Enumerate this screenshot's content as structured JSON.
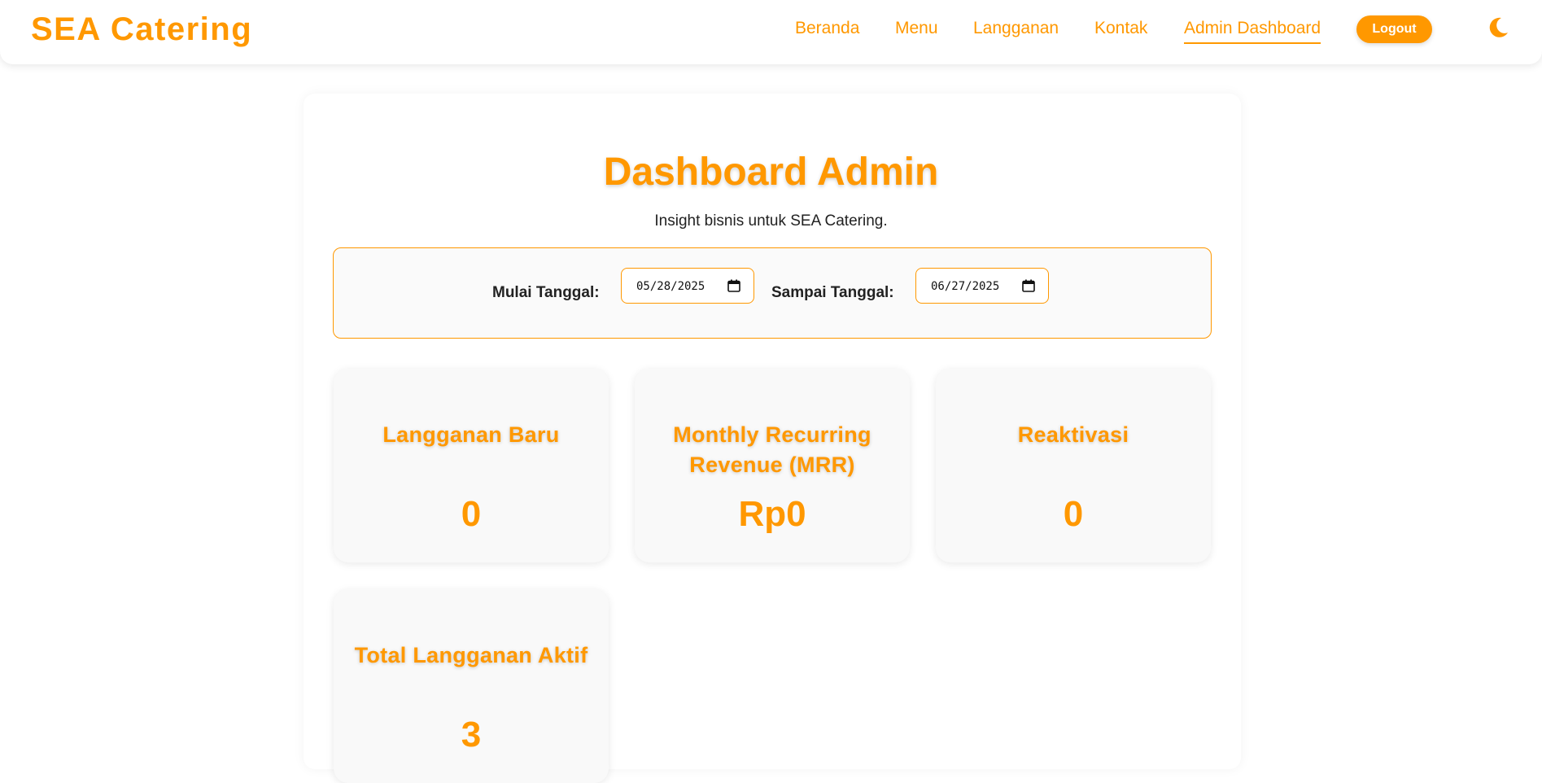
{
  "navbar": {
    "brand": "SEA Catering",
    "links": [
      "Beranda",
      "Menu",
      "Langganan",
      "Kontak",
      "Admin Dashboard"
    ],
    "active_link": "Admin Dashboard",
    "logout_label": "Logout",
    "theme_toggle_icon": "moon-icon",
    "accent_color": "#FF9800"
  },
  "page": {
    "title": "Dashboard Admin",
    "subtitle": "Insight bisnis untuk SEA Catering."
  },
  "filter": {
    "start_label": "Mulai Tanggal:",
    "start_value": "05/28/2025",
    "end_label": "Sampai Tanggal:",
    "end_value": "06/27/2025",
    "calendar_icon": "calendar-icon"
  },
  "cards": [
    {
      "title": "Langganan Baru",
      "value": "0"
    },
    {
      "title": "Monthly Recurring Revenue (MRR)",
      "value": "Rp0"
    },
    {
      "title": "Reaktivasi",
      "value": "0"
    },
    {
      "title": "Total Langganan Aktif",
      "value": "3"
    }
  ]
}
